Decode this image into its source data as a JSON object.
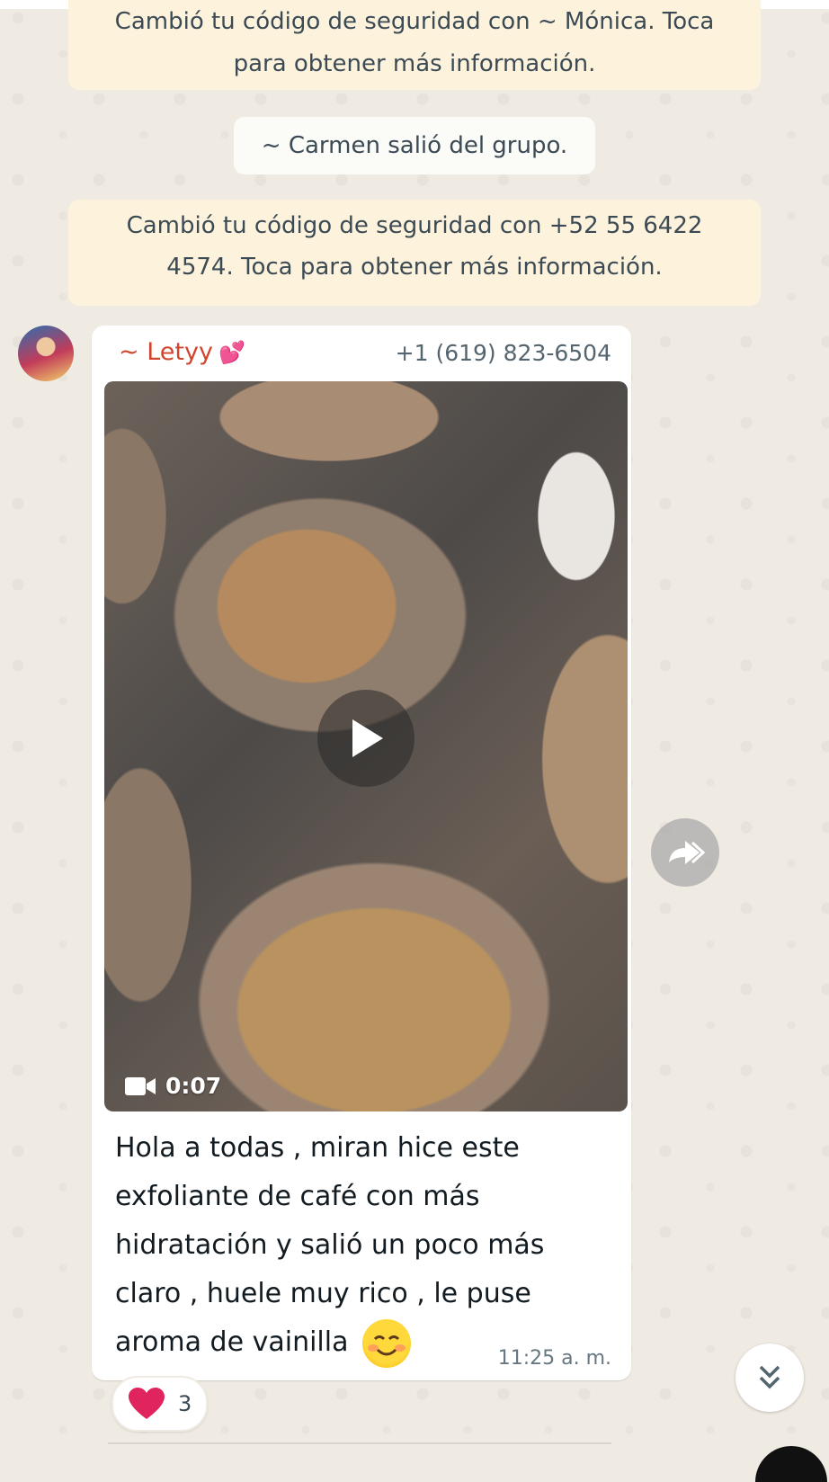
{
  "system_messages": [
    {
      "text_line1": "Cambió tu código de seguridad con ~ Mónica. Toca",
      "text_line2": "para obtener más información."
    },
    {
      "text": "~ Carmen salió del grupo."
    },
    {
      "text_line1": "Cambió tu código de seguridad con +52 55 6422",
      "text_line2": "4574. Toca para obtener más información."
    }
  ],
  "message": {
    "sender": "~ Letyy",
    "sender_emoji": "💕",
    "phone": "+1 (619) 823-6504",
    "video_duration": "0:07",
    "caption": "Hola a todas , miran hice este exfoliante de café con más hidratación y salió un poco más claro , huele muy rico , le puse aroma de vainilla",
    "time": "11:25 a. m.",
    "reaction": {
      "emoji": "❤",
      "count": "3"
    }
  },
  "colors": {
    "background": "#efeae2",
    "system_bubble": "#fdf3dc",
    "sender_name": "#d1452f",
    "heart": "#e0245e"
  },
  "icons": [
    "play-icon",
    "video-camera-icon",
    "forward-icon",
    "double-chevron-down-icon",
    "heart-icon",
    "smiling-face-emoji"
  ]
}
